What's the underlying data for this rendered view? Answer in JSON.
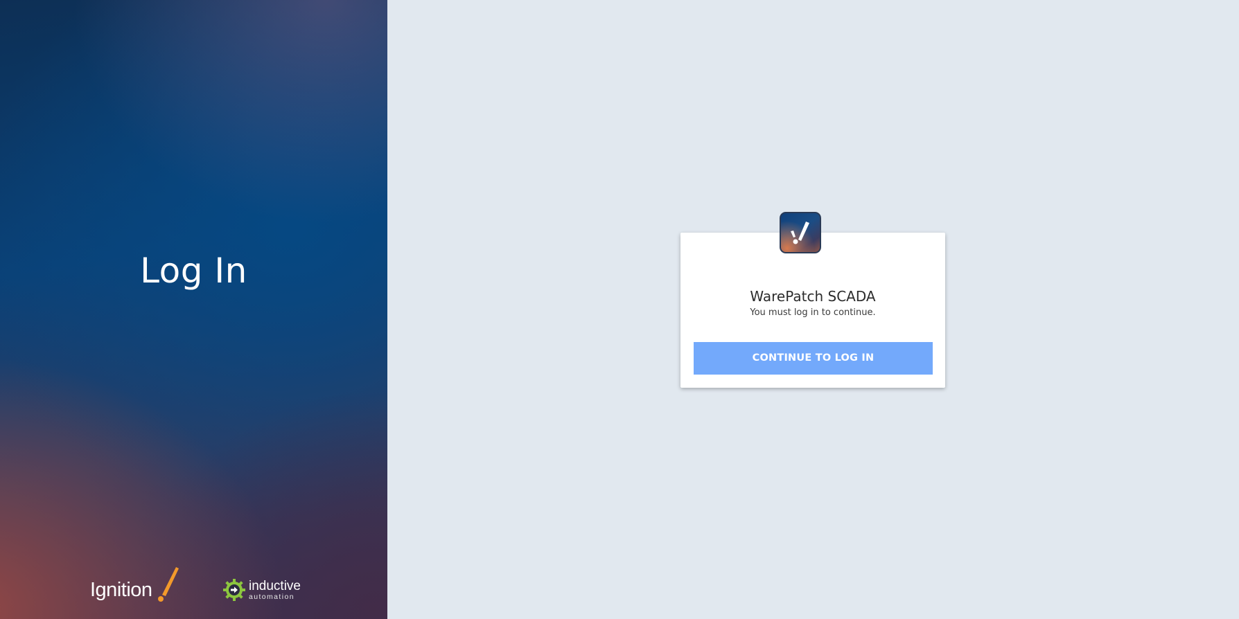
{
  "left_panel": {
    "title": "Log In",
    "ignition_logo_text": "Ignition",
    "inductive_logo": {
      "line1": "inductive",
      "line2": "automation"
    }
  },
  "card": {
    "app_icon": "ignition-exclamation-icon",
    "title": "WarePatch SCADA",
    "subtitle": "You must log in to continue.",
    "continue_button_label": "CONTINUE TO LOG IN"
  },
  "colors": {
    "page_background": "#e1e8ef",
    "button": "#73a9fb",
    "card_background": "#ffffff",
    "ignition_orange": "#f39a2b",
    "inductive_green": "#8dc63f"
  }
}
